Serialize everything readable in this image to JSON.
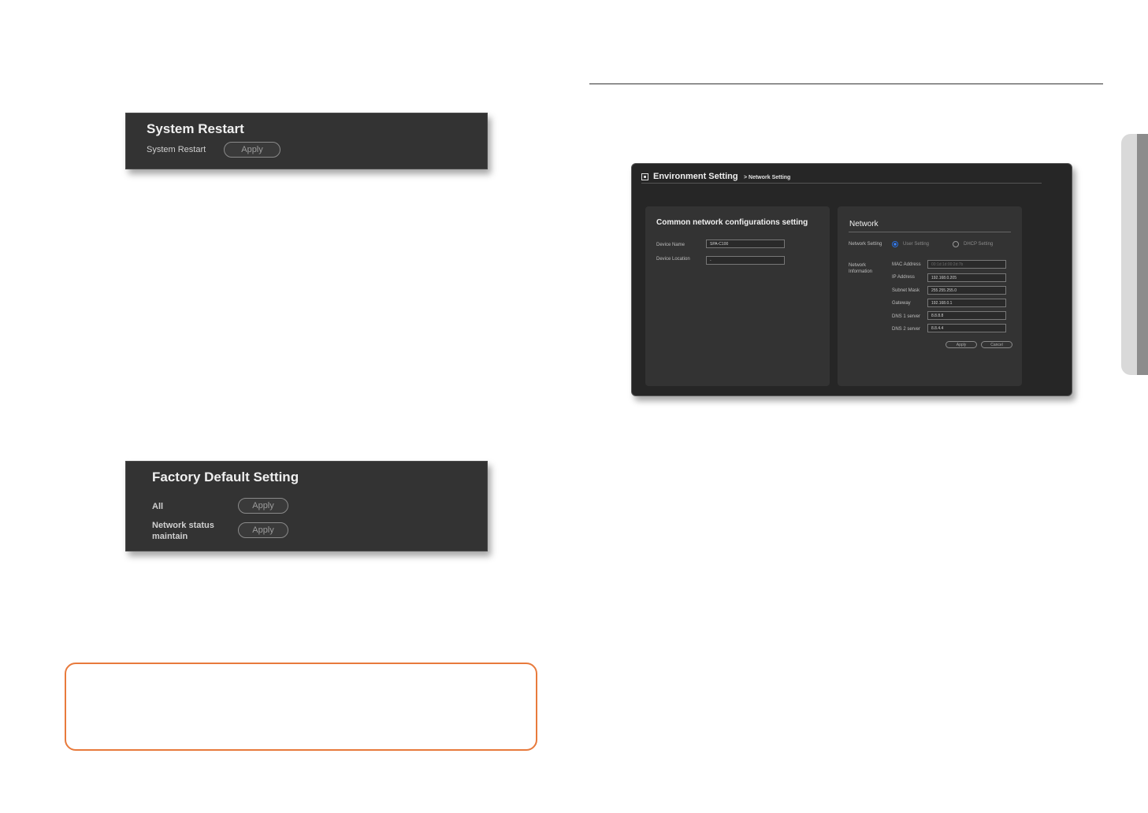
{
  "system_restart": {
    "title": "System Restart",
    "label": "System Restart",
    "button": "Apply"
  },
  "factory_default": {
    "title": "Factory Default Setting",
    "rows": [
      {
        "label": "All",
        "button": "Apply"
      },
      {
        "label": "Network status\nmaintain",
        "button": "Apply"
      }
    ]
  },
  "environment": {
    "title": "Environment Setting",
    "crumb": "> Network Setting",
    "common": {
      "title": "Common network configurations setting",
      "device_name_label": "Device Name",
      "device_name_value": "SPA-C100",
      "device_location_label": "Device Location",
      "device_location_value": "-"
    },
    "network": {
      "title": "Network",
      "setting_label": "Network Setting",
      "user_setting": "User Setting",
      "dhcp_setting": "DHCP Setting",
      "info_label": "Network\nInformation",
      "fields": [
        {
          "label": "MAC Address",
          "value": "00:1d:1d:00:2d:7b",
          "dim": true
        },
        {
          "label": "IP Address",
          "value": "192.168.0.205"
        },
        {
          "label": "Subnet Mask",
          "value": "255.255.255.0"
        },
        {
          "label": "Gateway",
          "value": "192.168.0.1"
        },
        {
          "label": "DNS 1 server",
          "value": "8.8.8.8"
        },
        {
          "label": "DNS 2 server",
          "value": "8.8.4.4"
        }
      ],
      "apply": "Apply",
      "cancel": "Cancel"
    }
  },
  "colors": {
    "panel_bg": "#333333",
    "note_border": "#e87a3c",
    "accent_blue": "#3b82f6"
  }
}
